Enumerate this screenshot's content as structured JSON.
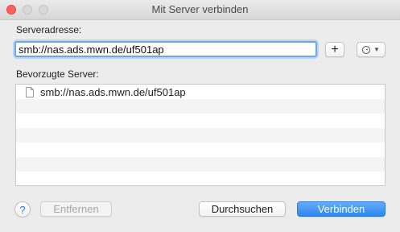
{
  "window": {
    "title": "Mit Server verbinden"
  },
  "form": {
    "server_address_label": "Serveradresse:",
    "server_address_value": "smb://nas.ads.mwn.de/uf501ap",
    "add_label": "+",
    "favorites_label": "Bevorzugte Server:"
  },
  "favorites": [
    {
      "address": "smb://nas.ads.mwn.de/uf501ap"
    },
    {
      "address": ""
    },
    {
      "address": ""
    },
    {
      "address": ""
    },
    {
      "address": ""
    },
    {
      "address": ""
    },
    {
      "address": ""
    }
  ],
  "buttons": {
    "help_label": "?",
    "remove_label": "Entfernen",
    "browse_label": "Durchsuchen",
    "connect_label": "Verbinden"
  },
  "colors": {
    "accent": "#2e86f0",
    "close": "#fc605b",
    "focus_ring": "#6aa7f0"
  }
}
